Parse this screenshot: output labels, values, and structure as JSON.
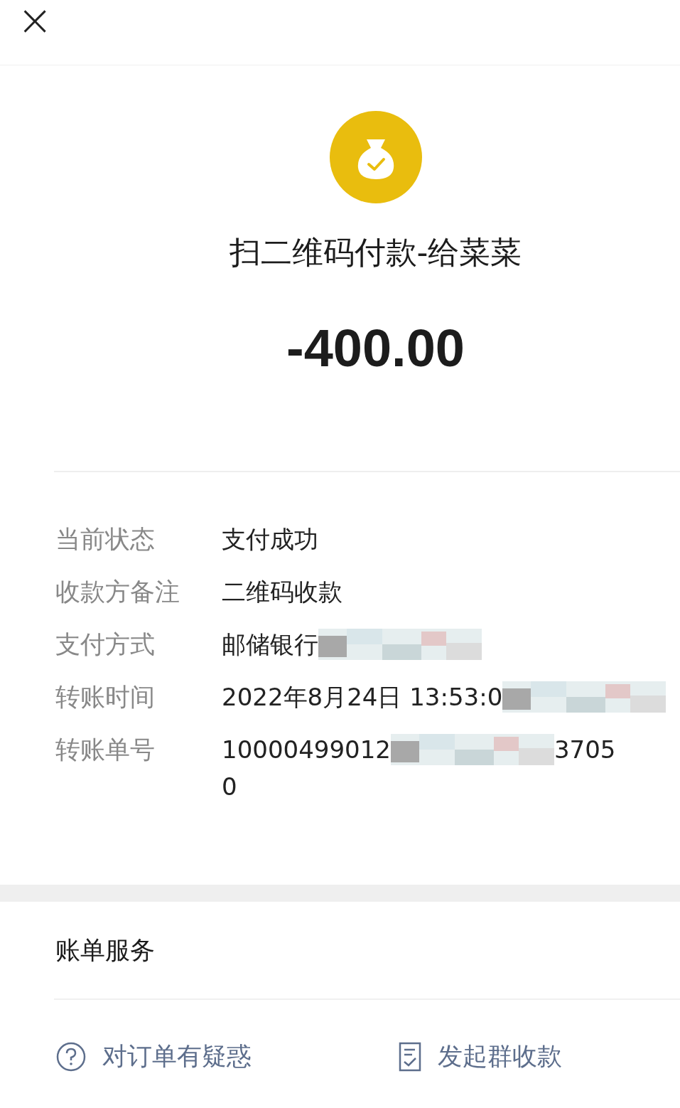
{
  "header": {
    "close": "×"
  },
  "payment": {
    "title": "扫二维码付款-给菜菜",
    "amount": "-400.00"
  },
  "details": [
    {
      "label": "当前状态",
      "lines": [
        [
          {
            "kind": "text",
            "text": "支付成功"
          }
        ]
      ]
    },
    {
      "label": "收款方备注",
      "lines": [
        [
          {
            "kind": "text",
            "text": "二维码收款"
          }
        ]
      ]
    },
    {
      "label": "支付方式",
      "lines": [
        [
          {
            "kind": "text",
            "text": "邮储银行"
          },
          {
            "kind": "redaction"
          }
        ]
      ]
    },
    {
      "label": "转账时间",
      "lines": [
        [
          {
            "kind": "text",
            "text": "2022年8月24日 13:53:0"
          },
          {
            "kind": "redaction"
          }
        ]
      ]
    },
    {
      "label": "转账单号",
      "lines": [
        [
          {
            "kind": "text",
            "text": "10000499012"
          },
          {
            "kind": "redaction"
          },
          {
            "kind": "text",
            "text": "3705"
          }
        ],
        [
          {
            "kind": "text",
            "text": "0"
          }
        ]
      ]
    }
  ],
  "services": {
    "title": "账单服务",
    "actions": [
      {
        "kind": "question",
        "label": "对订单有疑惑"
      },
      {
        "kind": "bill",
        "label": "发起群收款"
      }
    ]
  }
}
